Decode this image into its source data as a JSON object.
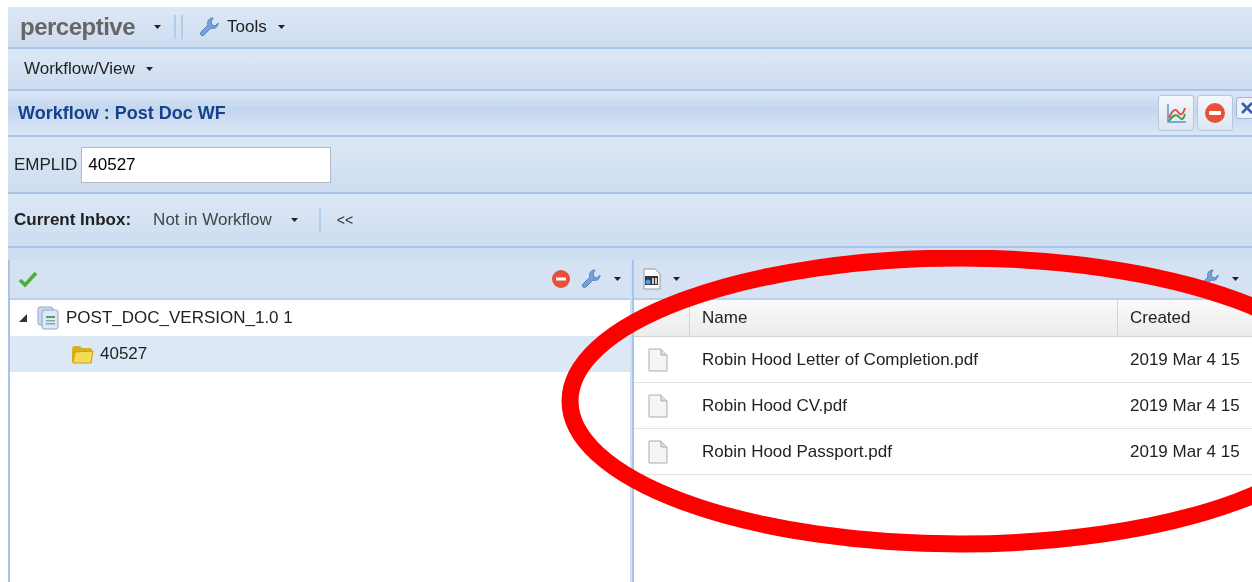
{
  "top_bar": {
    "logo": "perceptive",
    "menus": [
      {
        "label": "Tools"
      }
    ]
  },
  "view_bar": {
    "menu": "Workflow/View"
  },
  "panel": {
    "title": "Workflow : Post Doc WF"
  },
  "emplid": {
    "label": "EMPLID",
    "value": "40527"
  },
  "inbox": {
    "label": "Current Inbox:",
    "value": "Not in Workflow",
    "collapse": "<<"
  },
  "tree": [
    {
      "label": "POST_DOC_VERSION_1.0 1",
      "expanded": true,
      "selected": false,
      "children": [
        {
          "label": "40527",
          "selected": true
        }
      ]
    }
  ],
  "documents": {
    "columns": [
      "Name",
      "Created"
    ],
    "rows": [
      {
        "name": "Robin Hood Letter of Completion.pdf",
        "created": "2019 Mar 4 15"
      },
      {
        "name": "Robin Hood CV.pdf",
        "created": "2019 Mar 4 15"
      },
      {
        "name": "Robin Hood Passport.pdf",
        "created": "2019 Mar 4 15"
      }
    ]
  },
  "annotation": {
    "kind": "ellipse"
  }
}
